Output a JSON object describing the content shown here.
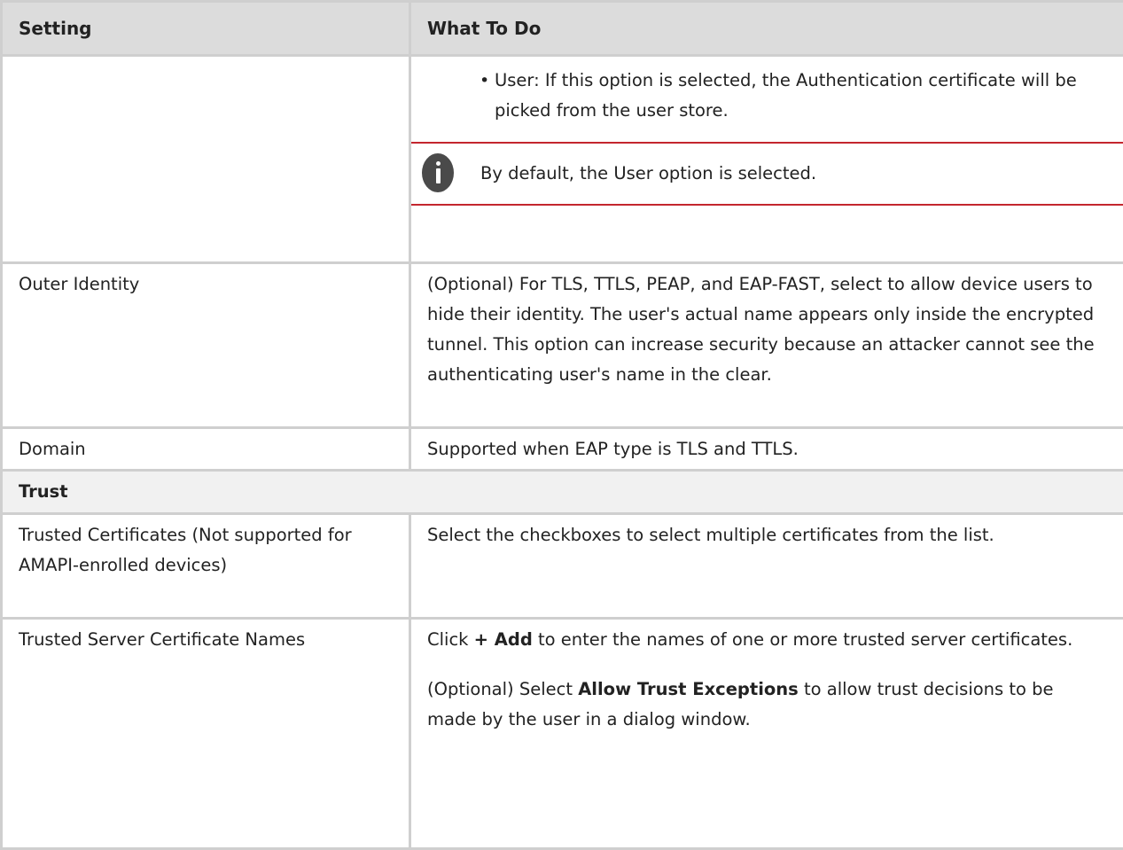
{
  "table": {
    "header": {
      "setting": "Setting",
      "what_to_do": "What To Do"
    },
    "rows": {
      "auth_store": {
        "setting": "",
        "bullet": "User: If this option is selected, the Authentication certificate will be picked from the user store.",
        "note": "By default, the User option is selected."
      },
      "outer_identity": {
        "setting": "Outer Identity",
        "text": "(Optional) For TLS, TTLS, PEAP, and EAP-FAST, select to allow device users to hide their identity. The user's actual name appears only inside the encrypted tunnel. This option can increase security because an attacker cannot see the authenticating user's name in the clear."
      },
      "domain": {
        "setting": "Domain",
        "text": "Supported when EAP type is TLS and TTLS."
      },
      "trust_section": {
        "label": "Trust"
      },
      "trusted_certificates": {
        "setting": "Trusted Certificates (Not supported for AMAPI-enrolled devices)",
        "text": "Select the checkboxes to select multiple certificates from the list."
      },
      "trusted_server_names": {
        "setting": "Trusted Server Certificate Names",
        "p1_pre": "Click ",
        "p1_bold": "+ Add",
        "p1_post": " to enter the names of one or more trusted server certificates.",
        "p2_pre": "(Optional) Select ",
        "p2_bold": "Allow Trust Exceptions",
        "p2_post": " to allow trust decisions to be made by the user in a dialog window."
      }
    }
  },
  "icons": {
    "note": "info-icon"
  },
  "colors": {
    "header_bg": "#dcdcdc",
    "section_bg": "#f1f1f1",
    "note_rule": "#c4262e",
    "border": "#cfcfcf"
  }
}
